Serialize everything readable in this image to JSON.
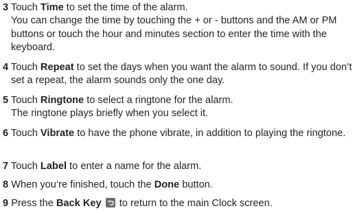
{
  "steps": [
    {
      "number": "3",
      "line1": {
        "pre": "Touch ",
        "keyword": "Time",
        "post": " to set the time of the alarm."
      },
      "continuation": "You can change the time by touching the + or - buttons and the AM or PM buttons or touch the hour and minutes section to enter the time with the keyboard."
    },
    {
      "number": "4",
      "line1": {
        "pre": "Touch ",
        "keyword": "Repeat",
        "post": " to set the days when you want the alarm to sound. If you don’t set a repeat, the alarm sounds only the one day."
      }
    },
    {
      "number": "5",
      "line1": {
        "pre": "Touch ",
        "keyword": "Ringtone",
        "post": " to select a ringtone for the alarm."
      },
      "continuation": "The ringtone plays briefly when you select it."
    },
    {
      "number": "6",
      "line1": {
        "pre": "Touch ",
        "keyword": "Vibrate",
        "post": " to have the phone vibrate, in addition to playing the ringtone."
      }
    },
    {
      "number": "7",
      "line1": {
        "pre": "Touch ",
        "keyword": "Label",
        "post": " to enter a name for the alarm."
      }
    },
    {
      "number": "8",
      "line1": {
        "pre": "When you’re finished, touch the ",
        "keyword": "Done",
        "post": " button."
      }
    },
    {
      "number": "9",
      "line1": {
        "pre": "Press the ",
        "keyword": "Back Key",
        "post": " to return to the main Clock screen."
      },
      "icon": "back-key-icon"
    }
  ]
}
